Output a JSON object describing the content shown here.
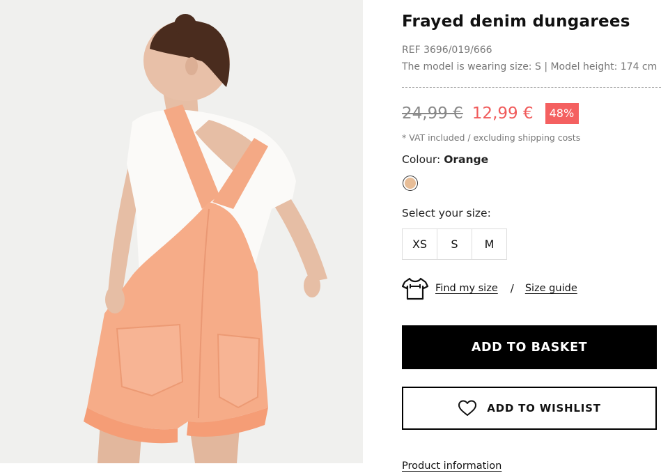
{
  "product": {
    "title": "Frayed denim dungarees",
    "ref": "REF 3696/019/666",
    "model_info": "The model is wearing size: S | Model height: 174 cm"
  },
  "price": {
    "original": "24,99 €",
    "current": "12,99 €",
    "discount": "48%",
    "vat_note": "* VAT included / excluding shipping costs"
  },
  "colour": {
    "label": "Colour:",
    "selected": "Orange",
    "swatch_color": "#e7bd97"
  },
  "size": {
    "label": "Select your size:",
    "options": [
      "XS",
      "S",
      "M"
    ]
  },
  "fit": {
    "icon": "tshirt-measure-icon",
    "find_label": "Find my size",
    "separator": "/",
    "guide_label": "Size guide"
  },
  "actions": {
    "add_basket": "ADD TO BASKET",
    "add_wishlist": "ADD TO WISHLIST",
    "wishlist_icon": "heart-icon"
  },
  "footer": {
    "product_info": "Product information"
  },
  "colors": {
    "sale_red": "#f05a5a",
    "badge_red": "#f46060",
    "primary_button": "#000000"
  }
}
